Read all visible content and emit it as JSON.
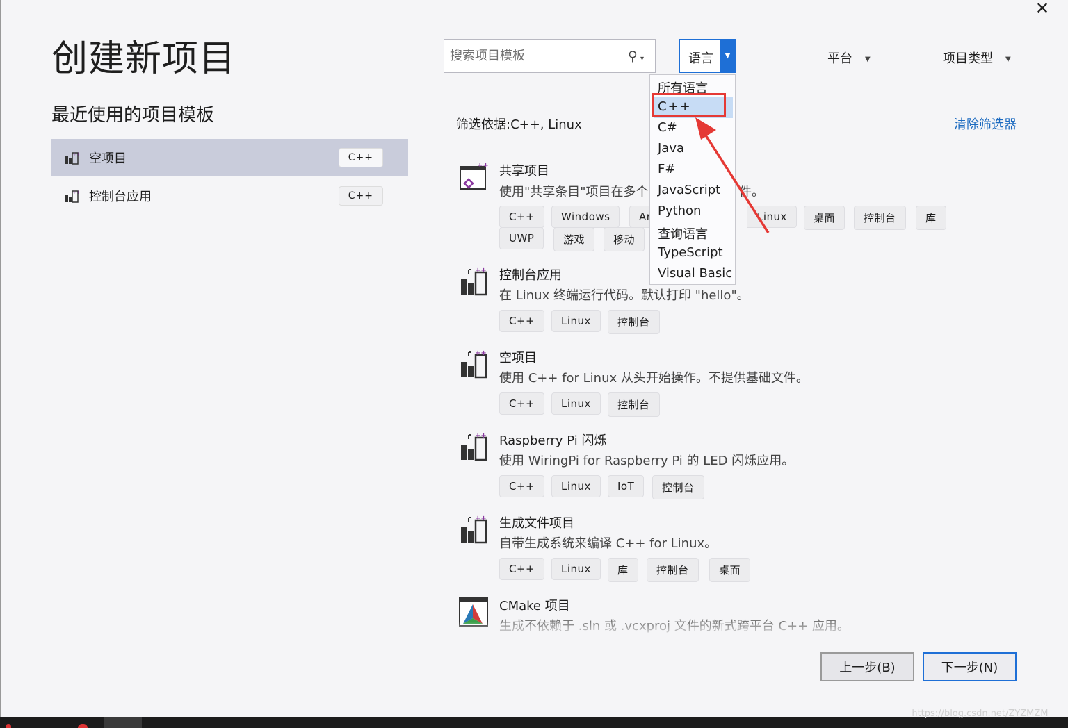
{
  "window": {
    "title": "创建新项目"
  },
  "recent": {
    "heading": "最近使用的项目模板",
    "items": [
      {
        "label": "空项目",
        "tag": "C++"
      },
      {
        "label": "控制台应用",
        "tag": "C++"
      }
    ]
  },
  "search": {
    "placeholder": "搜索项目模板"
  },
  "filters": {
    "language": "语言",
    "platform": "平台",
    "project_type": "项目类型",
    "filter_text": "筛选依据:C++, Linux",
    "clear_label": "清除筛选器"
  },
  "language_dropdown": {
    "options": [
      "所有语言",
      "C++",
      "C#",
      "Java",
      "F#",
      "JavaScript",
      "Python",
      "查询语言",
      "TypeScript",
      "Visual Basic"
    ],
    "highlighted": "C++"
  },
  "templates": [
    {
      "name": "共享项目",
      "desc": "使用\"共享条目\"项目在多个项",
      "desc_tail": "件。",
      "tags": [
        "C++",
        "Windows",
        "Ar",
        "Linux",
        "桌面",
        "控制台",
        "库",
        "UWP",
        "游戏",
        "移动"
      ]
    },
    {
      "name": "控制台应用",
      "desc": "在 Linux 终端运行代码。默认打印 \"hello\"。",
      "tags": [
        "C++",
        "Linux",
        "控制台"
      ]
    },
    {
      "name": "空项目",
      "desc": "使用 C++ for Linux 从头开始操作。不提供基础文件。",
      "tags": [
        "C++",
        "Linux",
        "控制台"
      ]
    },
    {
      "name": "Raspberry Pi 闪烁",
      "desc": "使用 WiringPi for Raspberry Pi 的 LED 闪烁应用。",
      "tags": [
        "C++",
        "Linux",
        "IoT",
        "控制台"
      ]
    },
    {
      "name": "生成文件项目",
      "desc": "自带生成系统来编译 C++ for Linux。",
      "tags": [
        "C++",
        "Linux",
        "库",
        "控制台",
        "桌面"
      ]
    },
    {
      "name": "CMake 项目",
      "desc": "生成不依赖于 .sln 或 .vcxproj 文件的新式跨平台 C++ 应用。",
      "tags": []
    }
  ],
  "buttons": {
    "back": "上一步(B)",
    "next": "下一步(N)"
  },
  "watermark": "https://blog.csdn.net/ZYZMZM_",
  "colors": {
    "accent": "#1e6fd6",
    "link": "#1b6ac0",
    "annotation_red": "#e53935",
    "selected_bg": "#c9ccdb"
  }
}
